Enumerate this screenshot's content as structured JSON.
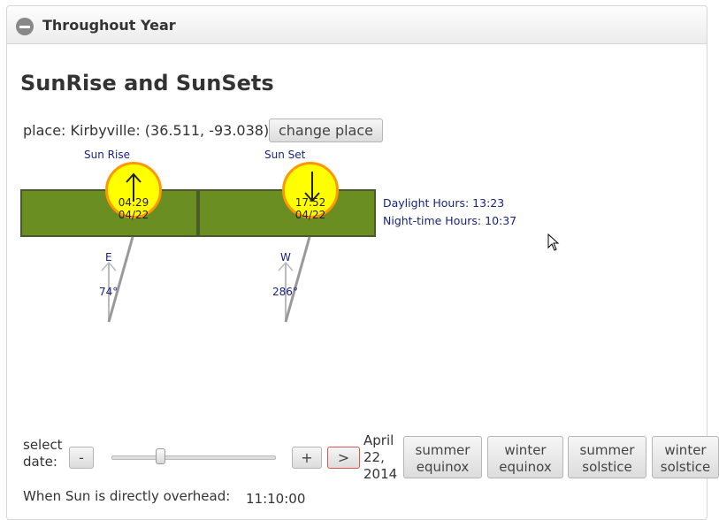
{
  "panel": {
    "title": "Throughout Year"
  },
  "page_title": "SunRise and SunSets",
  "place": {
    "text": "place: Kirbyville: (36.511, -93.038)",
    "change_label": "change place"
  },
  "sunrise": {
    "label": "Sun Rise",
    "time": "04:29",
    "date": "04/22",
    "direction": "E",
    "azimuth": "74°",
    "icon": "arrow-up-icon"
  },
  "sunset": {
    "label": "Sun Set",
    "time": "17:52",
    "date": "04/22",
    "direction": "W",
    "azimuth": "286°",
    "icon": "arrow-down-icon"
  },
  "daylight": {
    "daylight_text": "Daylight Hours: 13:23",
    "night_text": "Night-time Hours: 10:37"
  },
  "date_control": {
    "label_line1": "select",
    "label_line2": "date:",
    "minus": "-",
    "plus": "+",
    "next": ">",
    "date_line1": "April",
    "date_line2": "22,",
    "date_line3": "2014",
    "slider_fraction": 0.3
  },
  "presets": [
    {
      "line1": "summer",
      "line2": "equinox"
    },
    {
      "line1": "winter",
      "line2": "equinox"
    },
    {
      "line1": "summer",
      "line2": "solstice"
    },
    {
      "line1": "winter",
      "line2": "solstice"
    }
  ],
  "overhead": {
    "label": "When Sun is directly overhead:",
    "value": "11:10:00"
  },
  "colors": {
    "bar": "#6b8e23",
    "sun": "#ffff00",
    "sun_border": "#ff9800",
    "info_text": "#1a237e",
    "next_border": "#d9534f"
  }
}
